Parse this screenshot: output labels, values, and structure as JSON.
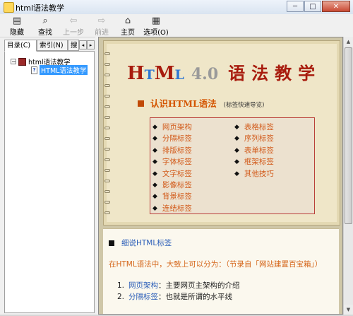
{
  "window": {
    "title": "html语法教学",
    "controls": {
      "minimize": "─",
      "maximize": "□",
      "close": "✕"
    }
  },
  "toolbar": [
    {
      "label": "隐藏",
      "icon": "hide-icon",
      "glyph": "▤",
      "enabled": true
    },
    {
      "label": "查找",
      "icon": "search-icon",
      "glyph": "⌕",
      "enabled": true
    },
    {
      "label": "上一步",
      "icon": "back-arrow-icon",
      "glyph": "⇦",
      "enabled": false
    },
    {
      "label": "前进",
      "icon": "forward-arrow-icon",
      "glyph": "⇨",
      "enabled": false
    },
    {
      "label": "主页",
      "icon": "home-icon",
      "glyph": "⌂",
      "enabled": true
    },
    {
      "label": "选项(O)",
      "icon": "options-icon",
      "glyph": "▦",
      "enabled": true
    }
  ],
  "left_pane": {
    "tabs": [
      "目录(C)",
      "索引(N)",
      "搜"
    ],
    "tab_scroll": [
      "◂",
      "▸"
    ],
    "tree": [
      {
        "label": "html语法教学",
        "type": "book",
        "expander": "−"
      },
      {
        "label": "HTML语法教学",
        "type": "page",
        "selected": true
      }
    ]
  },
  "content": {
    "heading": {
      "h": "H",
      "t": "T",
      "m": "M",
      "l": "L",
      "version": "4.0",
      "chinese": "语法教学"
    },
    "section": {
      "label": "认识HTML语法",
      "sub": "(标签快速导览)"
    },
    "nav_left": [
      "网页架构",
      "分隔标签",
      "排版标签",
      "字体标签",
      "文字标签",
      "影像标签",
      "背景标签",
      "连结标签"
    ],
    "nav_right": [
      "表格标签",
      "序列标签",
      "表单标签",
      "框架标签",
      "其他技巧"
    ],
    "lower": {
      "title": "细说HTML标签",
      "intro": "在HTML语法中，大致上可以分为：（节录自「网站建置百宝箱」）",
      "list": [
        {
          "num": "1.",
          "key": "网页架构",
          "desc": "：主要网页主架构的介绍"
        },
        {
          "num": "2.",
          "key": "分隔标签",
          "desc": "：也就是所谓的水平线"
        }
      ]
    }
  },
  "scrollbar": {
    "up": "▲",
    "down": "▼"
  }
}
